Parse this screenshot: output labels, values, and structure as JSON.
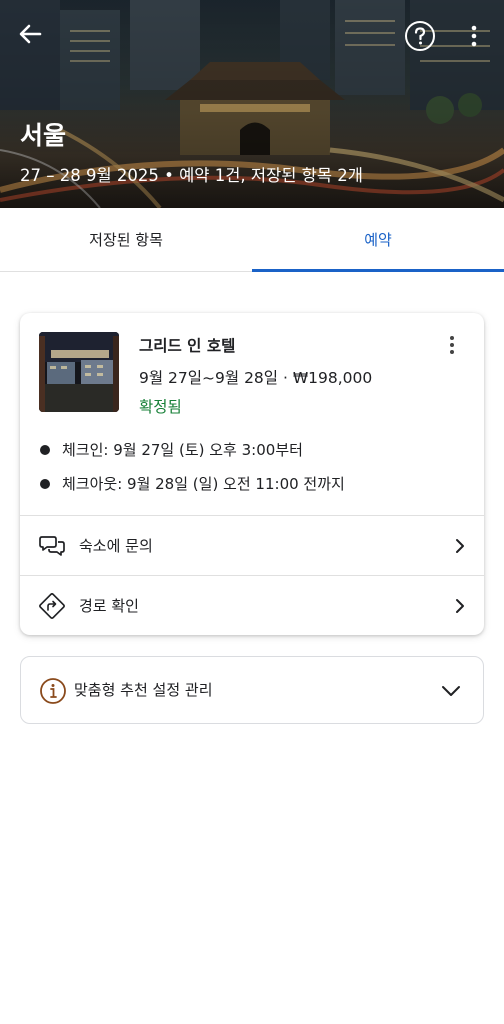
{
  "header": {
    "title": "서울",
    "subtitle": "27 – 28 9월 2025 • 예약 1건, 저장된 항목 2개",
    "icons": {
      "back": "arrow-left-icon",
      "help": "question-circle-icon",
      "more": "more-vert-icon"
    }
  },
  "tabs": [
    {
      "label": "저장된 항목",
      "active": false
    },
    {
      "label": "예약",
      "active": true
    }
  ],
  "booking": {
    "name": "그리드 인 호텔",
    "dates_price": "9월 27일~9월 28일 · ₩198,000",
    "status": "확정됨",
    "status_color": "#188038",
    "checkin": "체크인: 9월 27일 (토) 오후 3:00부터",
    "checkout": "체크아웃: 9월 28일 (일) 오전 11:00 전까지",
    "actions": [
      {
        "label": "숙소에 문의",
        "icon": "chat-bubbles-icon"
      },
      {
        "label": "경로 확인",
        "icon": "directions-icon"
      }
    ]
  },
  "prefs": {
    "label": "맞춤형 추천 설정 관리",
    "icon": "info-circle-icon"
  },
  "colors": {
    "accent": "#1a62c7",
    "confirmed": "#188038",
    "info_icon": "#8a4a1c"
  }
}
